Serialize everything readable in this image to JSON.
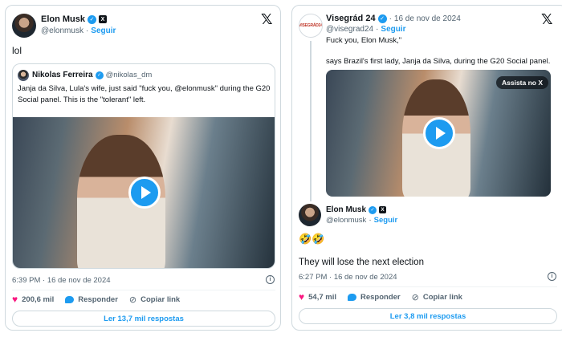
{
  "left": {
    "author_name": "Elon Musk",
    "author_handle": "@elonmusk",
    "follow": "Seguir",
    "tweet_text": "lol",
    "quote": {
      "author_name": "Nikolas Ferreira",
      "author_handle": "@nikolas_dm",
      "text_line1": "Janja da Silva, Lula's wife, just said \"fuck you, @elonmusk\" during the G20",
      "text_line2": "Social panel. This is the \"tolerant\" left."
    },
    "time": "6:39 PM · 16 de nov de 2024",
    "likes": "200,6 mil",
    "reply_label": "Responder",
    "copy_label": "Copiar link",
    "read_replies": "Ler 13,7 mil respostas"
  },
  "right": {
    "author_name": "Visegrád 24",
    "date": "16 de nov de 2024",
    "author_handle": "@visegrad24",
    "follow": "Seguir",
    "text_line1": "Fuck you, Elon Musk,\"",
    "text_line2": "says Brazil's first lady, Janja da Silva, during the G20 Social panel.",
    "watch_pill": "Assista no X",
    "logo_text": "VISEGRÁD24",
    "reply": {
      "author_name": "Elon Musk",
      "author_handle": "@elonmusk",
      "follow": "Seguir",
      "emoji": "🤣🤣",
      "text": "They will lose the next election"
    },
    "time": "6:27 PM · 16 de nov de 2024",
    "likes": "54,7 mil",
    "reply_label": "Responder",
    "copy_label": "Copiar link",
    "read_replies": "Ler 3,8 mil respostas"
  },
  "icons": {
    "x_logo": "𝕏",
    "verified": "✓",
    "info": "i",
    "heart": "♥",
    "link": "🔗",
    "play": "play-icon"
  },
  "colors": {
    "accent": "#1d9bf0",
    "like": "#f91880",
    "text": "#0f1419",
    "muted": "#536471",
    "border": "#cfd9de"
  }
}
